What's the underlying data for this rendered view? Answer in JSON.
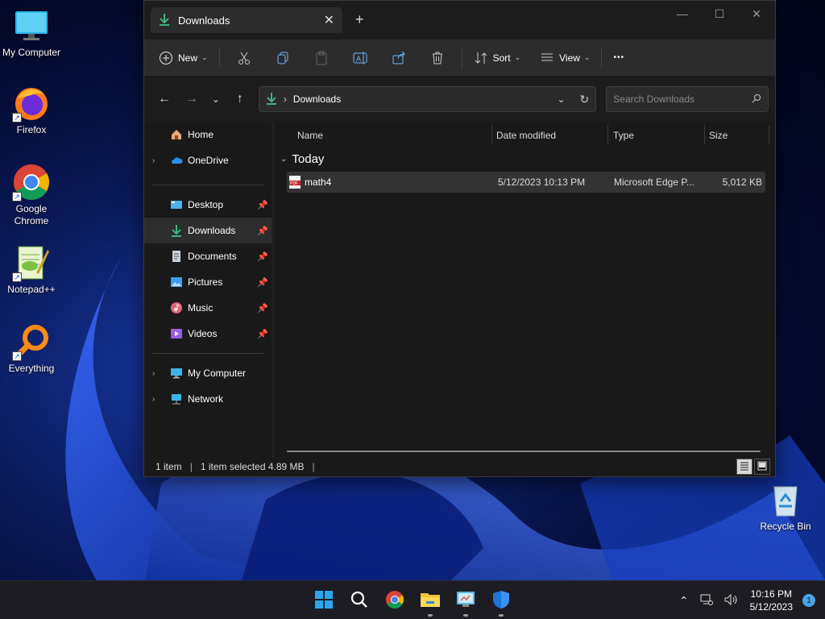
{
  "desktop": {
    "icons": [
      {
        "label": "My Computer"
      },
      {
        "label": "Firefox"
      },
      {
        "label": "Google Chrome"
      },
      {
        "label": "Notepad++"
      },
      {
        "label": "Everything"
      },
      {
        "label": "Recycle Bin"
      }
    ]
  },
  "window": {
    "tab_title": "Downloads",
    "new_tab": "+",
    "controls": {
      "minimize": "—",
      "maximize": "☐",
      "close": "✕"
    }
  },
  "toolbar": {
    "new_label": "New",
    "sort_label": "Sort",
    "view_label": "View",
    "more_label": "•••"
  },
  "address": {
    "path": "Downloads",
    "search_placeholder": "Search Downloads"
  },
  "nav": {
    "items": [
      {
        "label": "Home"
      },
      {
        "label": "OneDrive"
      },
      {
        "label": "Desktop"
      },
      {
        "label": "Downloads"
      },
      {
        "label": "Documents"
      },
      {
        "label": "Pictures"
      },
      {
        "label": "Music"
      },
      {
        "label": "Videos"
      },
      {
        "label": "My Computer"
      },
      {
        "label": "Network"
      }
    ]
  },
  "files": {
    "columns": [
      "Name",
      "Date modified",
      "Type",
      "Size"
    ],
    "group": "Today",
    "rows": [
      {
        "name": "math4",
        "date": "5/12/2023 10:13 PM",
        "type": "Microsoft Edge P...",
        "size": "5,012 KB"
      }
    ]
  },
  "status": {
    "count": "1 item",
    "selected": "1 item selected  4.89 MB"
  },
  "taskbar": {
    "time": "10:16 PM",
    "date": "5/12/2023",
    "notifications": "1"
  },
  "colors": {
    "accent": "#4cc2ff",
    "download_green": "#3fb27f"
  }
}
